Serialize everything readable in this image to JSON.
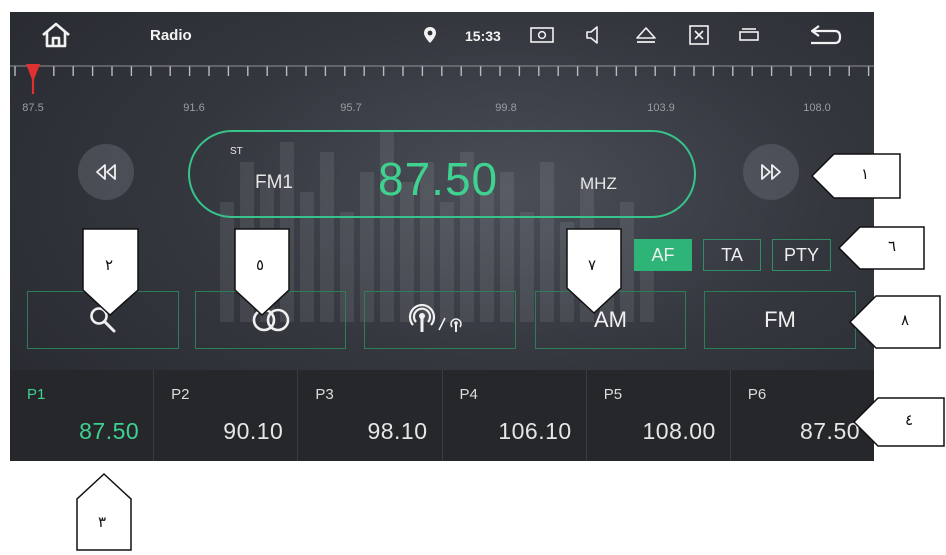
{
  "status_bar": {
    "title": "Radio",
    "time": "15:33",
    "icons": [
      "home-icon",
      "location-icon",
      "photo-icon",
      "volume-icon",
      "eject-icon",
      "close-box-icon",
      "window-icon",
      "back-icon"
    ]
  },
  "scale": {
    "labels": [
      "87.5",
      "91.6",
      "95.7",
      "99.8",
      "103.9",
      "108.0"
    ],
    "marker_color": "#e03030"
  },
  "tuner": {
    "stereo": "ST",
    "band": "FM1",
    "frequency": "87.50",
    "unit": "MHZ"
  },
  "options": {
    "af": "AF",
    "ta": "TA",
    "pty": "PTY",
    "af_active": true
  },
  "functions": {
    "am": "AM",
    "fm": "FM",
    "icons": [
      "search-icon",
      "stereo-icon",
      "antenna-icon"
    ]
  },
  "presets": [
    {
      "label": "P1",
      "freq": "87.50",
      "active": true
    },
    {
      "label": "P2",
      "freq": "90.10",
      "active": false
    },
    {
      "label": "P3",
      "freq": "98.10",
      "active": false
    },
    {
      "label": "P4",
      "freq": "106.10",
      "active": false
    },
    {
      "label": "P5",
      "freq": "108.00",
      "active": false
    },
    {
      "label": "P6",
      "freq": "87.50",
      "active": false
    }
  ],
  "callouts": {
    "c1": "١",
    "c2": "٢",
    "c3": "٣",
    "c4": "٤",
    "c5": "٥",
    "c6": "٦",
    "c7": "٧",
    "c8": "٨"
  },
  "colors": {
    "accent": "#3fd18f",
    "border": "#2d7d59",
    "background": "#2f3238"
  }
}
